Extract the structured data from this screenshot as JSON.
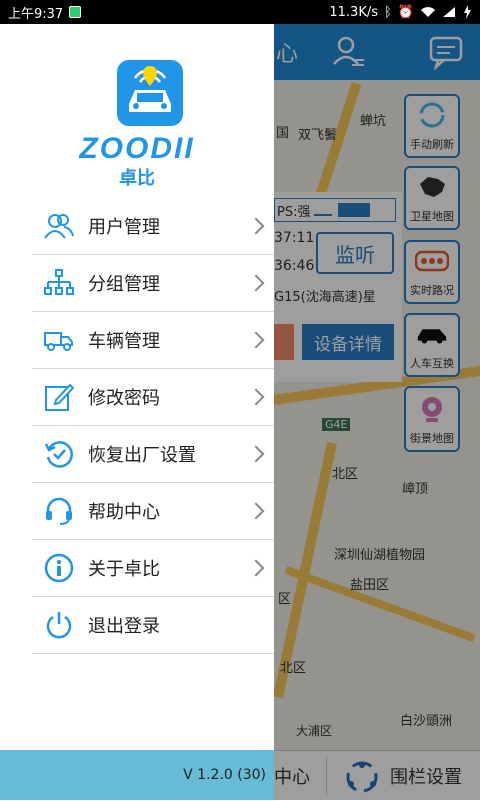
{
  "status": {
    "time": "上午9:37",
    "speed": "11.3K/s"
  },
  "background": {
    "header_title": "心",
    "map_labels": [
      "双飞鬐",
      "蝉坑",
      "G4E",
      "G15(沈海高速)星",
      "深圳仙湖植物园",
      "盐田区",
      "嶂顶",
      "白沙頭洲",
      "北区",
      "大浦区",
      "区",
      "国"
    ],
    "side_buttons": [
      "手动刷新",
      "卫星地图",
      "实时路况",
      "人车互换",
      "街景地图"
    ],
    "card": {
      "gps": "PS:强",
      "t1": "37:11",
      "t2": "36:46",
      "listen": "监听",
      "detail": "设备详情"
    },
    "bottom": {
      "left": "中心",
      "right": "围栏设置"
    }
  },
  "drawer": {
    "logo_word": "ZOODII",
    "logo_cn": "卓比",
    "menu": [
      {
        "label": "用户管理",
        "icon": "users-icon",
        "chevron": true
      },
      {
        "label": "分组管理",
        "icon": "org-chart-icon",
        "chevron": true
      },
      {
        "label": "车辆管理",
        "icon": "truck-icon",
        "chevron": true
      },
      {
        "label": "修改密码",
        "icon": "edit-icon",
        "chevron": true
      },
      {
        "label": "恢复出厂设置",
        "icon": "restore-icon",
        "chevron": true
      },
      {
        "label": "帮助中心",
        "icon": "headset-icon",
        "chevron": true
      },
      {
        "label": "关于卓比",
        "icon": "info-icon",
        "chevron": true
      },
      {
        "label": "退出登录",
        "icon": "power-icon",
        "chevron": false
      }
    ],
    "version": "V 1.2.0 (30)"
  },
  "colors": {
    "accent": "#2196e8",
    "footer": "#66bbd6",
    "header": "#1f89d6"
  }
}
